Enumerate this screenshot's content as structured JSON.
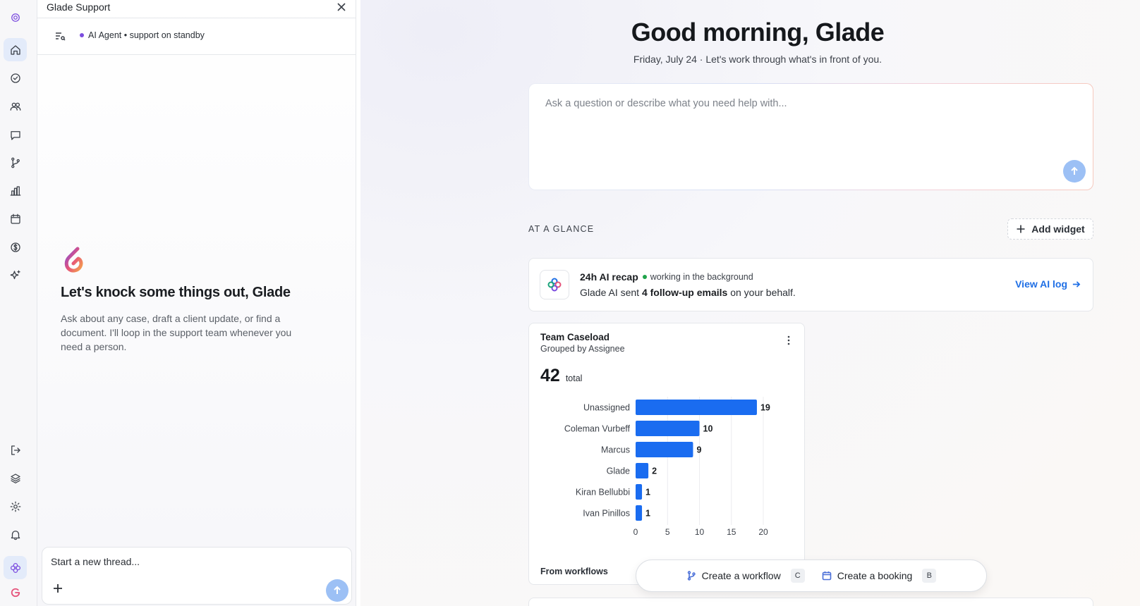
{
  "rail": {
    "items": [
      {
        "icon": "logo-icon"
      },
      {
        "icon": "home-icon",
        "active": true
      },
      {
        "icon": "check-circle-icon"
      },
      {
        "icon": "users-icon"
      },
      {
        "icon": "message-icon"
      },
      {
        "icon": "workflow-icon"
      },
      {
        "icon": "chart-icon"
      },
      {
        "icon": "calendar-icon"
      },
      {
        "icon": "dollar-icon"
      },
      {
        "icon": "sparkle-icon"
      },
      {
        "icon": "logout-icon"
      },
      {
        "icon": "layers-icon"
      },
      {
        "icon": "gear-icon"
      },
      {
        "icon": "bell-icon"
      },
      {
        "icon": "ai-flower-icon",
        "active": true
      },
      {
        "icon": "brand-logo-icon"
      }
    ]
  },
  "panel": {
    "title": "Glade Support",
    "agent_status": "AI Agent • support on standby",
    "intro_heading": "Let's knock some things out, Glade",
    "intro_body": "Ask about any case, draft a client update, or find a document. I'll loop in the support team whenever you need a person.",
    "composer_placeholder": "Start a new thread..."
  },
  "main": {
    "greeting": "Good morning, Glade",
    "date_line": "Friday, July 24  · Let's work through what's in front of you.",
    "ask_placeholder": "Ask a question or describe what you need help with...",
    "glance_label": "AT A GLANCE",
    "add_widget_label": "Add widget",
    "recap": {
      "title": "24h AI recap",
      "status": "working in the background",
      "body_prefix": "Glade AI sent ",
      "body_bold": "4 follow-up emails",
      "body_suffix": " on your behalf.",
      "link": "View AI log"
    },
    "caseload": {
      "title": "Team Caseload",
      "subtitle": "Grouped by Assignee",
      "total": "42",
      "total_label": "total",
      "footer": "From workflows"
    },
    "quick_actions": [
      {
        "label": "Create a workflow",
        "key": "C"
      },
      {
        "label": "Create a booking",
        "key": "B"
      }
    ]
  },
  "colors": {
    "accent": "#1f6fe5",
    "bar": "#1a6cf0",
    "status_green": "#1fa34a",
    "agent_purple": "#7c4ddf"
  },
  "chart_data": {
    "type": "bar",
    "orientation": "horizontal",
    "categories": [
      "Unassigned",
      "Coleman Vurbeff",
      "Marcus",
      "Glade",
      "Kiran Bellubbi",
      "Ivan Pinillos"
    ],
    "values": [
      19,
      10,
      9,
      2,
      1,
      1
    ],
    "xlim": [
      0,
      20
    ],
    "xticks": [
      0,
      5,
      10,
      15,
      20
    ],
    "grid": true
  }
}
